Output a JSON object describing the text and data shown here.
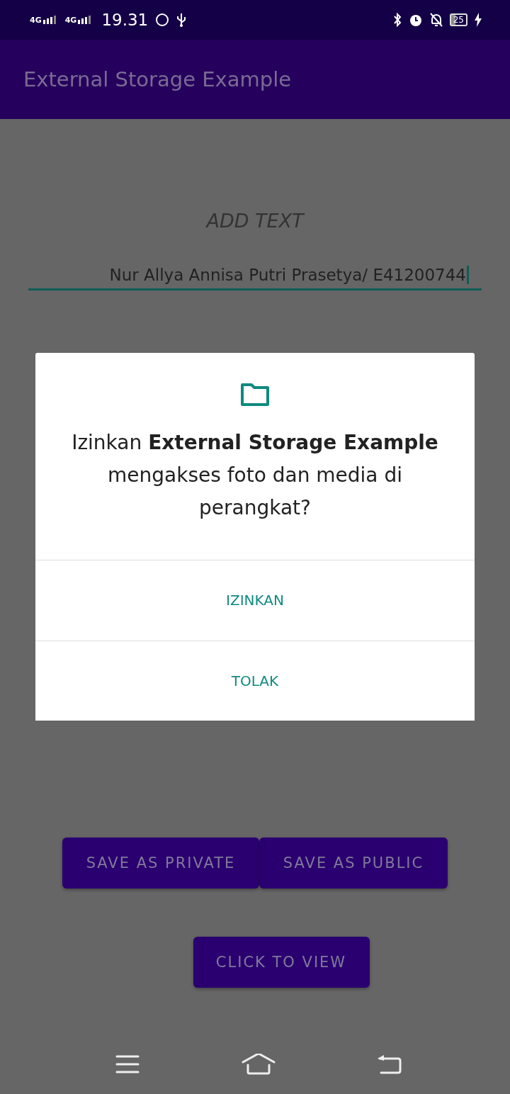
{
  "status_bar": {
    "network_1": "4G",
    "network_2": "4G",
    "time": "19.31",
    "battery": "25"
  },
  "app_bar": {
    "title": "External Storage Example"
  },
  "screen": {
    "heading": "ADD TEXT",
    "input": {
      "value": "Nur Allya Annisa Putri Prasetya/ E41200744"
    },
    "buttons": [
      {
        "label": "SAVE AS PRIVATE"
      },
      {
        "label": "SAVE AS PUBLIC"
      }
    ],
    "view_button": {
      "label": "CLICK TO VIEW"
    }
  },
  "dialog": {
    "message": "Izinkan **External Storage Example** mengakses foto dan media di perangkat?",
    "actions": [
      {
        "label": "IZINKAN"
      },
      {
        "label": "TOLAK"
      }
    ]
  }
}
